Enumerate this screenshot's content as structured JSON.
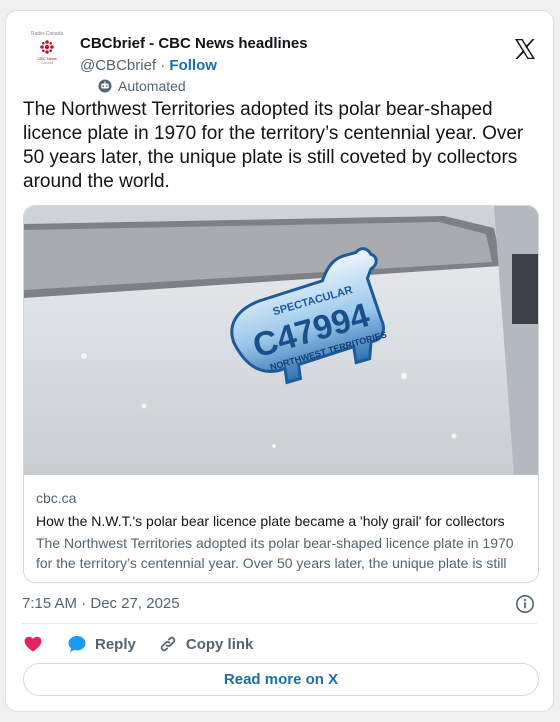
{
  "author": {
    "display_name": "CBCbrief - CBC News headlines",
    "handle": "@CBCbrief",
    "separator": "·",
    "follow_label": "Follow",
    "automated_label": "Automated",
    "avatar": {
      "top_text": "Radio-Canada",
      "brand_text": "CBC News",
      "sub_text": "Canada"
    }
  },
  "tweet": {
    "text": "The Northwest Territories adopted its polar bear-shaped licence plate in 1970 for the territory’s centennial year. Over 50 years later, the unique plate is still coveted by collectors around the world."
  },
  "link_card": {
    "domain": "cbc.ca",
    "title": "How the N.W.T.'s polar bear licence plate became a 'holy grail' for collectors",
    "description": "The Northwest Territories adopted its polar bear-shaped licence plate in 1970 for the territory’s centennial year. Over 50 years later, the unique plate is still coveted by collectors around the world.",
    "media": {
      "plate_top": "SPECTACULAR",
      "plate_number": "C47994",
      "plate_bottom": "NORTHWEST TERRITORIES"
    }
  },
  "timestamp": "7:15 AM · Dec 27, 2025",
  "actions": {
    "reply_label": "Reply",
    "copy_link_label": "Copy link",
    "read_more_label": "Read more on X"
  },
  "icons": {
    "like": "heart-icon",
    "reply": "reply-bubble-icon",
    "copy": "link-icon",
    "info": "info-icon",
    "brand": "x-logo-icon",
    "bot": "bot-icon"
  },
  "colors": {
    "accent": "#1d6fa5",
    "like": "#e0245e",
    "reply": "#1d9bf0",
    "muted": "#536471",
    "text": "#0f1419"
  }
}
